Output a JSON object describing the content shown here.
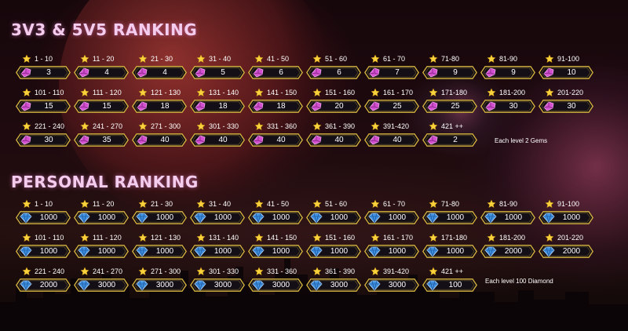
{
  "colors": {
    "title": "#f4cdee",
    "badge_border": "#d8b640",
    "badge_fill": "#140f16",
    "star": "#f8d13c",
    "gem": "#d24fd0",
    "diamond": "#3d8fe0"
  },
  "sections": [
    {
      "title": "3V3 & 5V5 RANKING",
      "reward_icon": "gem-icon",
      "note": "Each level 2 Gems",
      "tiers": [
        {
          "rank": "1 - 10",
          "reward": "3"
        },
        {
          "rank": "11 - 20",
          "reward": "4"
        },
        {
          "rank": "21 - 30",
          "reward": "4"
        },
        {
          "rank": "31 - 40",
          "reward": "5"
        },
        {
          "rank": "41 - 50",
          "reward": "6"
        },
        {
          "rank": "51 - 60",
          "reward": "6"
        },
        {
          "rank": "61 - 70",
          "reward": "7"
        },
        {
          "rank": "71-80",
          "reward": "9"
        },
        {
          "rank": "81-90",
          "reward": "9"
        },
        {
          "rank": "91-100",
          "reward": "10"
        },
        {
          "rank": "101 - 110",
          "reward": "15"
        },
        {
          "rank": "111 - 120",
          "reward": "15"
        },
        {
          "rank": "121 - 130",
          "reward": "18"
        },
        {
          "rank": "131 - 140",
          "reward": "18"
        },
        {
          "rank": "141 - 150",
          "reward": "18"
        },
        {
          "rank": "151 - 160",
          "reward": "20"
        },
        {
          "rank": "161 - 170",
          "reward": "25"
        },
        {
          "rank": "171-180",
          "reward": "25"
        },
        {
          "rank": "181-200",
          "reward": "30"
        },
        {
          "rank": "201-220",
          "reward": "30"
        },
        {
          "rank": "221 - 240",
          "reward": "30"
        },
        {
          "rank": "241 - 270",
          "reward": "35"
        },
        {
          "rank": "271 - 300",
          "reward": "40"
        },
        {
          "rank": "301 - 330",
          "reward": "40"
        },
        {
          "rank": "331 - 360",
          "reward": "40"
        },
        {
          "rank": "361 - 390",
          "reward": "40"
        },
        {
          "rank": "391-420",
          "reward": "40"
        },
        {
          "rank": "421 ++",
          "reward": "2"
        }
      ]
    },
    {
      "title": "PERSONAL RANKING",
      "reward_icon": "diamond-icon",
      "note": "Each level 100 Diamond",
      "tiers": [
        {
          "rank": "1 - 10",
          "reward": "1000"
        },
        {
          "rank": "11 - 20",
          "reward": "1000"
        },
        {
          "rank": "21 - 30",
          "reward": "1000"
        },
        {
          "rank": "31 - 40",
          "reward": "1000"
        },
        {
          "rank": "41 - 50",
          "reward": "1000"
        },
        {
          "rank": "51 - 60",
          "reward": "1000"
        },
        {
          "rank": "61 - 70",
          "reward": "1000"
        },
        {
          "rank": "71-80",
          "reward": "1000"
        },
        {
          "rank": "81-90",
          "reward": "1000"
        },
        {
          "rank": "91-100",
          "reward": "1000"
        },
        {
          "rank": "101 - 110",
          "reward": "1000"
        },
        {
          "rank": "111 - 120",
          "reward": "1000"
        },
        {
          "rank": "121 - 130",
          "reward": "1000"
        },
        {
          "rank": "131 - 140",
          "reward": "1000"
        },
        {
          "rank": "141 - 150",
          "reward": "1000"
        },
        {
          "rank": "151 - 160",
          "reward": "1000"
        },
        {
          "rank": "161 - 170",
          "reward": "1000"
        },
        {
          "rank": "171-180",
          "reward": "1000"
        },
        {
          "rank": "181-200",
          "reward": "2000"
        },
        {
          "rank": "201-220",
          "reward": "2000"
        },
        {
          "rank": "221 - 240",
          "reward": "2000"
        },
        {
          "rank": "241 - 270",
          "reward": "3000"
        },
        {
          "rank": "271 - 300",
          "reward": "3000"
        },
        {
          "rank": "301 - 330",
          "reward": "3000"
        },
        {
          "rank": "331 - 360",
          "reward": "3000"
        },
        {
          "rank": "361 - 390",
          "reward": "3000"
        },
        {
          "rank": "391-420",
          "reward": "3000"
        },
        {
          "rank": "421 ++",
          "reward": "100"
        }
      ]
    }
  ]
}
